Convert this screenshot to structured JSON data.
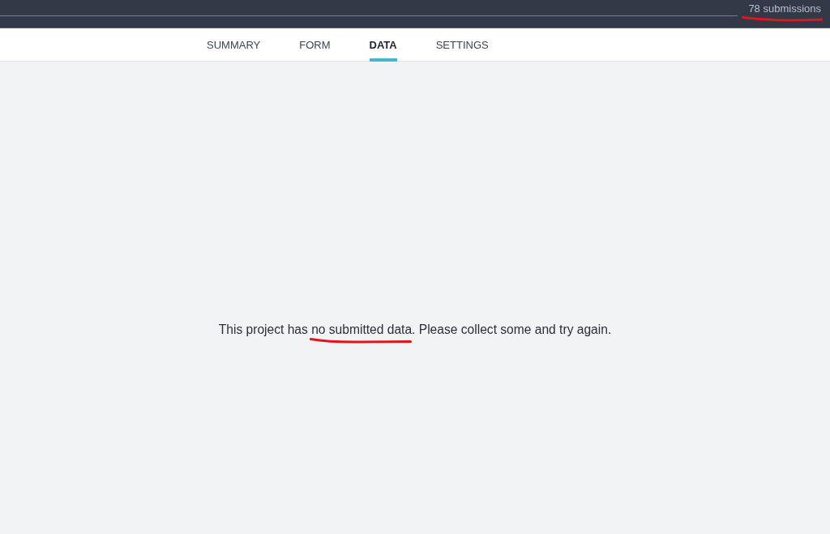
{
  "header": {
    "submissions": {
      "text": "78 submissions",
      "marked": true
    }
  },
  "tabs": [
    {
      "label": "SUMMARY",
      "selected": false
    },
    {
      "label": "FORM",
      "selected": false
    },
    {
      "label": "DATA",
      "selected": true
    },
    {
      "label": "SETTINGS",
      "selected": false
    }
  ],
  "message": {
    "parts": [
      {
        "text": "This project has ",
        "kind": "plain"
      },
      {
        "text": "no submitted data",
        "kind": "marked"
      },
      {
        "text": ". Please collect some and try again.",
        "kind": "plain"
      }
    ]
  }
}
